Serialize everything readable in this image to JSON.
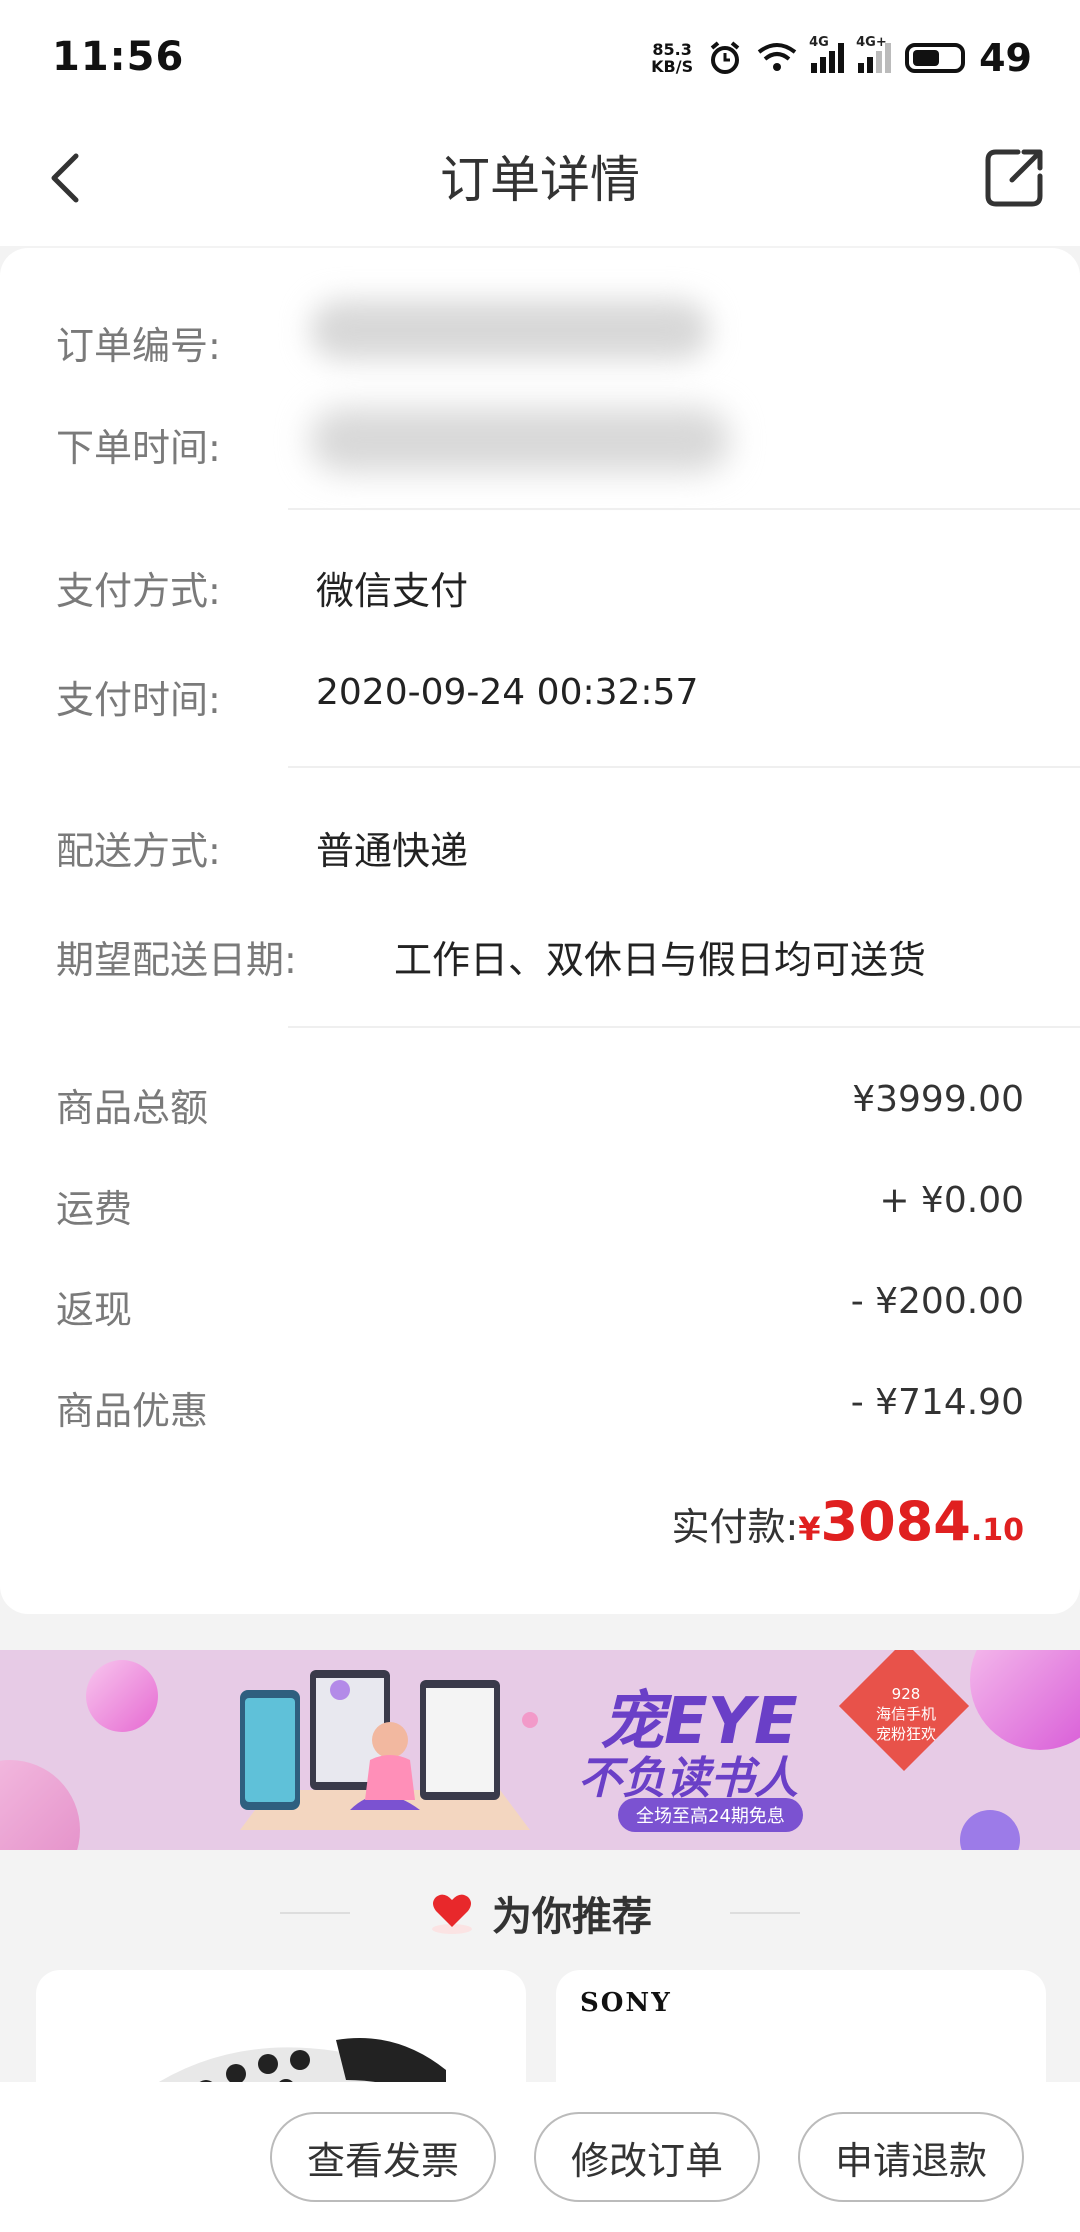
{
  "status_bar": {
    "time": "11:56",
    "net_speed_value": "85.3",
    "net_speed_unit": "KB/S",
    "signal1_tag": "4G",
    "signal2_tag": "4G+",
    "battery": "49"
  },
  "header": {
    "title": "订单详情"
  },
  "order": {
    "number_label": "订单编号:",
    "time_label": "下单时间:",
    "pay_method_label": "支付方式:",
    "pay_method_value": "微信支付",
    "pay_time_label": "支付时间:",
    "pay_time_value": "2020-09-24 00:32:57",
    "delivery_label": "配送方式:",
    "delivery_value": "普通快递",
    "expected_date_label": "期望配送日期:",
    "expected_date_value": "工作日、双休日与假日均可送货"
  },
  "amounts": {
    "goods_total_label": "商品总额",
    "goods_total_value": "¥3999.00",
    "freight_label": "运费",
    "freight_value": "+ ¥0.00",
    "cashback_label": "返现",
    "cashback_value": "- ¥200.00",
    "discount_label": "商品优惠",
    "discount_value": "- ¥714.90",
    "paid_label": "实付款:",
    "paid_yen": "¥",
    "paid_integer": "3084",
    "paid_decimal": ".10"
  },
  "banner": {
    "title_line1": "宠EYE",
    "title_line2": "不负读书人",
    "pill_text": "全场至高24期免息",
    "badge_line1": "928",
    "badge_line2": "海信手机",
    "badge_line3": "宠粉狂欢"
  },
  "recommend": {
    "title": "为你推荐",
    "product2_brand": "SONY"
  },
  "bottom_bar": {
    "invoice_button": "查看发票",
    "modify_button": "修改订单",
    "refund_button": "申请退款"
  },
  "colors": {
    "accent_red": "#e02020",
    "banner_purple": "#6a3fc7"
  }
}
